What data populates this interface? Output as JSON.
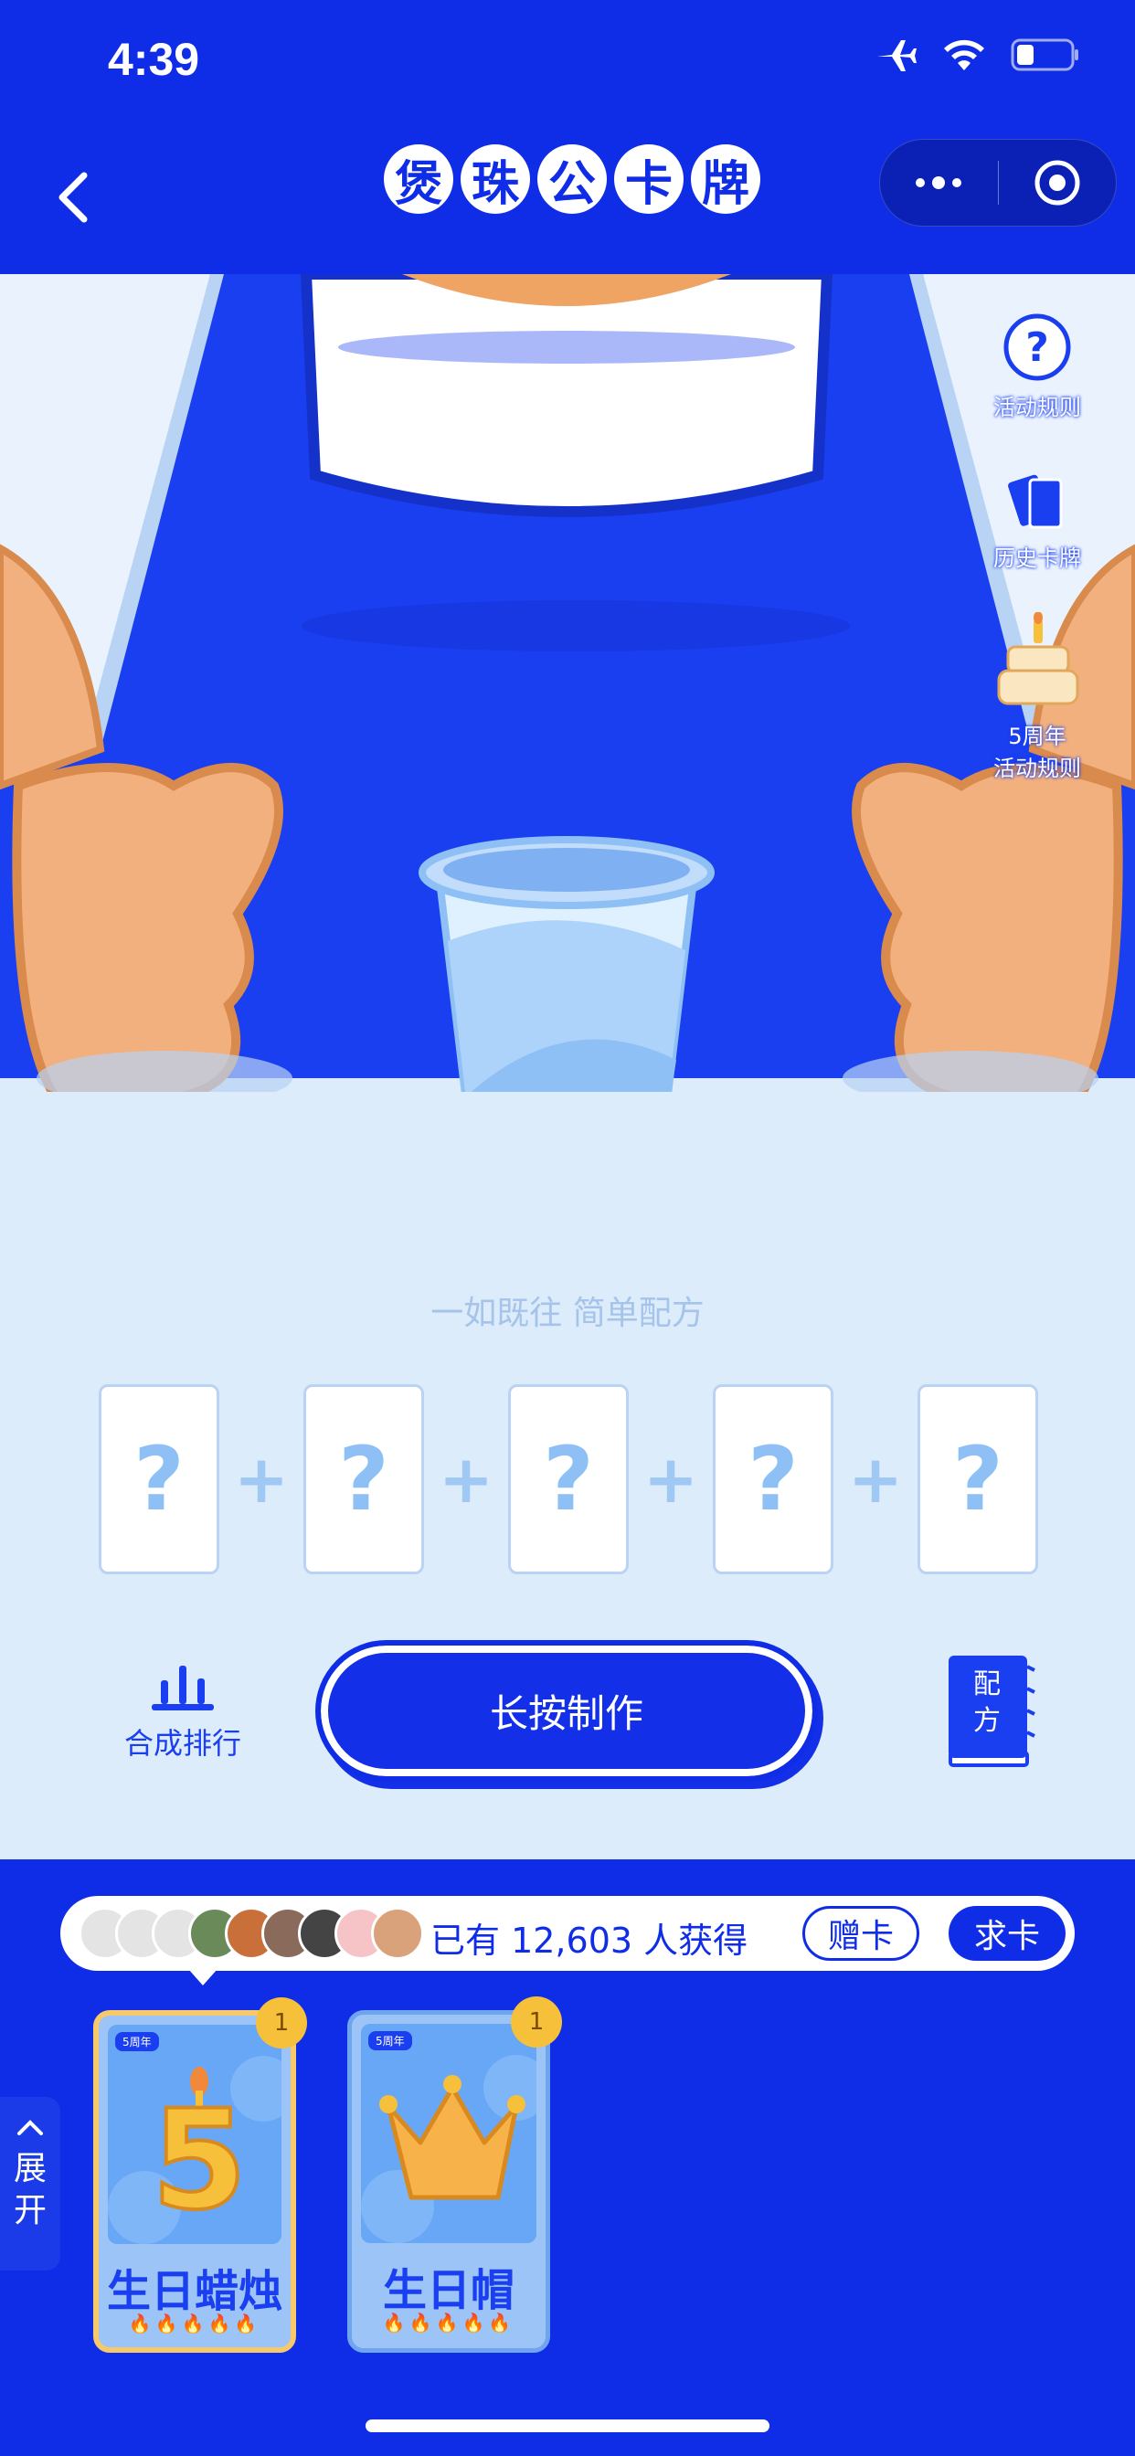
{
  "status": {
    "time": "4:39"
  },
  "nav": {
    "title_chars": [
      "煲",
      "珠",
      "公",
      "卡",
      "牌"
    ]
  },
  "side_menu": {
    "rules": "活动规则",
    "history": "历史卡牌",
    "anniv_line1": "5周年",
    "anniv_line2": "活动规则"
  },
  "main": {
    "slogan": "一如既往 简单配方",
    "slot_placeholder": "?",
    "plus": "+",
    "rank_label": "合成排行",
    "make_button": "长按制作",
    "recipe_line1": "配",
    "recipe_line2": "方"
  },
  "bottom": {
    "count_text": "已有 12,603 人获得",
    "gift_button": "赠卡",
    "request_button": "求卡",
    "expand_line1": "展",
    "expand_line2": "开",
    "cards": [
      {
        "tag": "5周年",
        "name": "生日蜡烛",
        "badge": "1",
        "candle_number": "5",
        "flames": "🔥🔥🔥🔥🔥"
      },
      {
        "tag": "5周年",
        "name": "生日帽",
        "badge": "1",
        "flames": "🔥🔥🔥🔥🔥"
      }
    ]
  },
  "colors": {
    "primary": "#0f2de6",
    "light_bg": "#dcecfb",
    "card_border_selected": "#f7c96a",
    "badge": "#f7c03a"
  }
}
